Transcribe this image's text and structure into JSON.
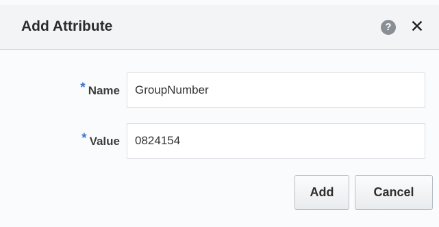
{
  "dialog": {
    "title": "Add Attribute",
    "help_icon": "help-icon",
    "help_glyph": "?",
    "close_icon": "close-icon",
    "close_glyph": "✕"
  },
  "form": {
    "required_marker": "*",
    "name": {
      "label": "Name",
      "value": "GroupNumber"
    },
    "value": {
      "label": "Value",
      "value": "0824154"
    }
  },
  "buttons": {
    "add_label": "Add",
    "cancel_label": "Cancel"
  },
  "colors": {
    "required_marker": "#3979c5",
    "header_background": "#f2f4f6",
    "help_icon_background": "#8a8f96"
  }
}
